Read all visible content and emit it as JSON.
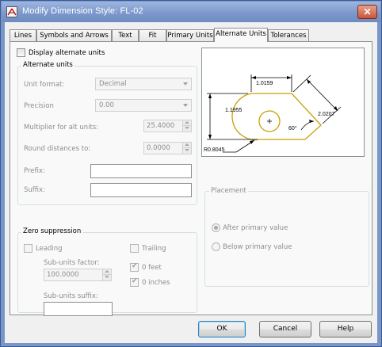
{
  "window": {
    "title": "Modify Dimension Style: FL-02",
    "close_glyph": "✕"
  },
  "tabs": [
    {
      "label": "Lines"
    },
    {
      "label": "Symbols and Arrows"
    },
    {
      "label": "Text"
    },
    {
      "label": "Fit"
    },
    {
      "label": "Primary Units"
    },
    {
      "label": "Alternate Units"
    },
    {
      "label": "Tolerances"
    }
  ],
  "active_tab": "Alternate Units",
  "display_alternate_units": {
    "label": "Display alternate units",
    "checked": false
  },
  "alternate_units": {
    "title": "Alternate units",
    "unit_format_label": "Unit format:",
    "unit_format_value": "Decimal",
    "precision_label": "Precision",
    "precision_value": "0.00",
    "multiplier_label": "Multiplier for alt units:",
    "multiplier_value": "25.4000",
    "round_label": "Round distances to:",
    "round_value": "0.0000",
    "prefix_label": "Prefix:",
    "prefix_value": "",
    "suffix_label": "Suffix:",
    "suffix_value": ""
  },
  "zero_suppression": {
    "title": "Zero suppression",
    "leading_label": "Leading",
    "leading_checked": false,
    "subunits_factor_label": "Sub-units factor:",
    "subunits_factor_value": "100.0000",
    "subunits_suffix_label": "Sub-units suffix:",
    "subunits_suffix_value": "",
    "trailing_label": "Trailing",
    "trailing_checked": false,
    "feet_label": "0 feet",
    "feet_checked": true,
    "inches_label": "0 inches",
    "inches_checked": true
  },
  "preview": {
    "dim_top": "1.0159",
    "dim_left": "1.1955",
    "dim_right": "2.0207",
    "dim_angle": "60°",
    "dim_radius": "R0.8045",
    "colors": {
      "part": "#c8a000",
      "dimension": "#000000"
    }
  },
  "placement": {
    "title": "Placement",
    "after_primary_label": "After primary value",
    "after_primary_selected": true,
    "below_primary_label": "Below primary value",
    "below_primary_selected": false
  },
  "buttons": {
    "ok": "OK",
    "cancel": "Cancel",
    "help": "Help"
  },
  "theme": {
    "titlebar": "#7a97cb",
    "disabled_text": "#8d8d8d",
    "accent_focus": "#3c7fb1"
  }
}
